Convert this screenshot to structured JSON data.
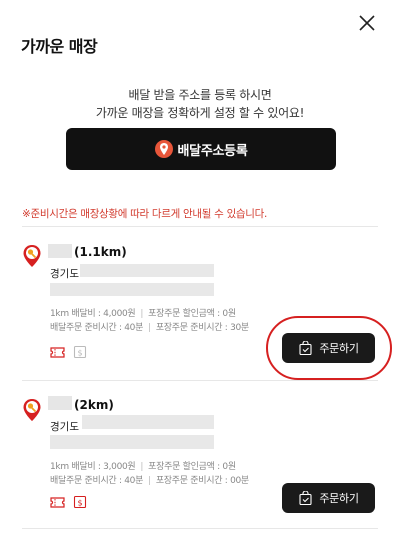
{
  "header": {
    "title": "가까운 매장"
  },
  "guide": {
    "line1": "배달 받을 주소를 등록 하시면",
    "line2": "가까운 매장을 정확하게 설정 할 수 있어요!"
  },
  "register_button": {
    "label": "배달주소등록"
  },
  "notice": "※준비시간은 매장상황에 따라 다르게 안내될 수 있습니다.",
  "stores": [
    {
      "distance": "(1.1km)",
      "region": "경기도",
      "delivery_fee": "1km 배달비 : 4,000원",
      "takeout_discount": "포장주문 할인금액 : 0원",
      "delivery_prep": "배달주문 준비시간 : 40분",
      "takeout_prep": "포장주문 준비시간 : 30분",
      "order_label": "주문하기"
    },
    {
      "distance": "(2km)",
      "region": "경기도",
      "delivery_fee": "1km 배달비 : 3,000원",
      "takeout_discount": "포장주문 할인금액 : 0원",
      "delivery_prep": "배달주문 준비시간 : 40분",
      "takeout_prep": "포장주문 준비시간 : 00분",
      "order_label": "주문하기"
    }
  ],
  "colors": {
    "accent_red": "#d23b2e",
    "button_dark": "#111111",
    "pin_orange": "#e8563a"
  },
  "icons": [
    "close-icon",
    "location-pin-icon",
    "store-marker-icon",
    "coupon-icon",
    "takeout-bag-icon",
    "order-bag-icon"
  ]
}
